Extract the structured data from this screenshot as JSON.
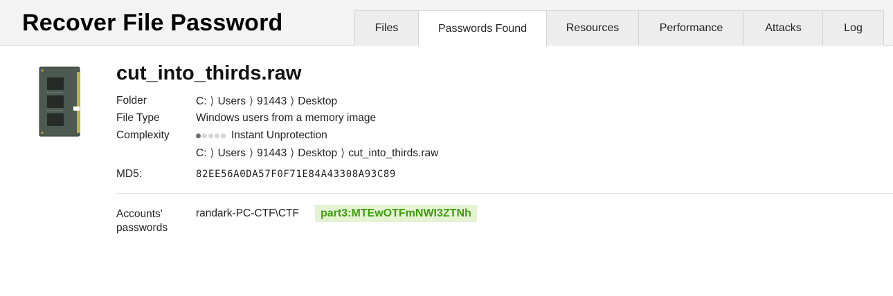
{
  "app": {
    "title": "Recover File Password"
  },
  "tabs": [
    {
      "label": "Files",
      "active": false
    },
    {
      "label": "Passwords Found",
      "active": true
    },
    {
      "label": "Resources",
      "active": false
    },
    {
      "label": "Performance",
      "active": false
    },
    {
      "label": "Attacks",
      "active": false
    },
    {
      "label": "Log",
      "active": false
    }
  ],
  "file": {
    "icon": "memory-module-icon",
    "name": "cut_into_thirds.raw",
    "folder_label": "Folder",
    "folder_path": [
      "C:",
      "Users",
      "91443",
      "Desktop"
    ],
    "type_label": "File Type",
    "type_value": "Windows users from a memory image",
    "complexity_label": "Complexity",
    "complexity_level": 1,
    "complexity_max": 5,
    "complexity_text": "Instant Unprotection",
    "full_path": [
      "C:",
      "Users",
      "91443",
      "Desktop",
      "cut_into_thirds.raw"
    ],
    "md5_label": "MD5:",
    "md5_value": "82EE56A0DA57F0F71E84A43308A93C89"
  },
  "accounts": {
    "label_line1": "Accounts'",
    "label_line2": "passwords",
    "account": "randark-PC-CTF\\CTF",
    "password": "part3:MTEwOTFmNWI3ZTNh"
  },
  "colors": {
    "password_text": "#3f9d0c",
    "password_bg": "#e5f3d5",
    "header_bg": "#f3f3f3"
  }
}
